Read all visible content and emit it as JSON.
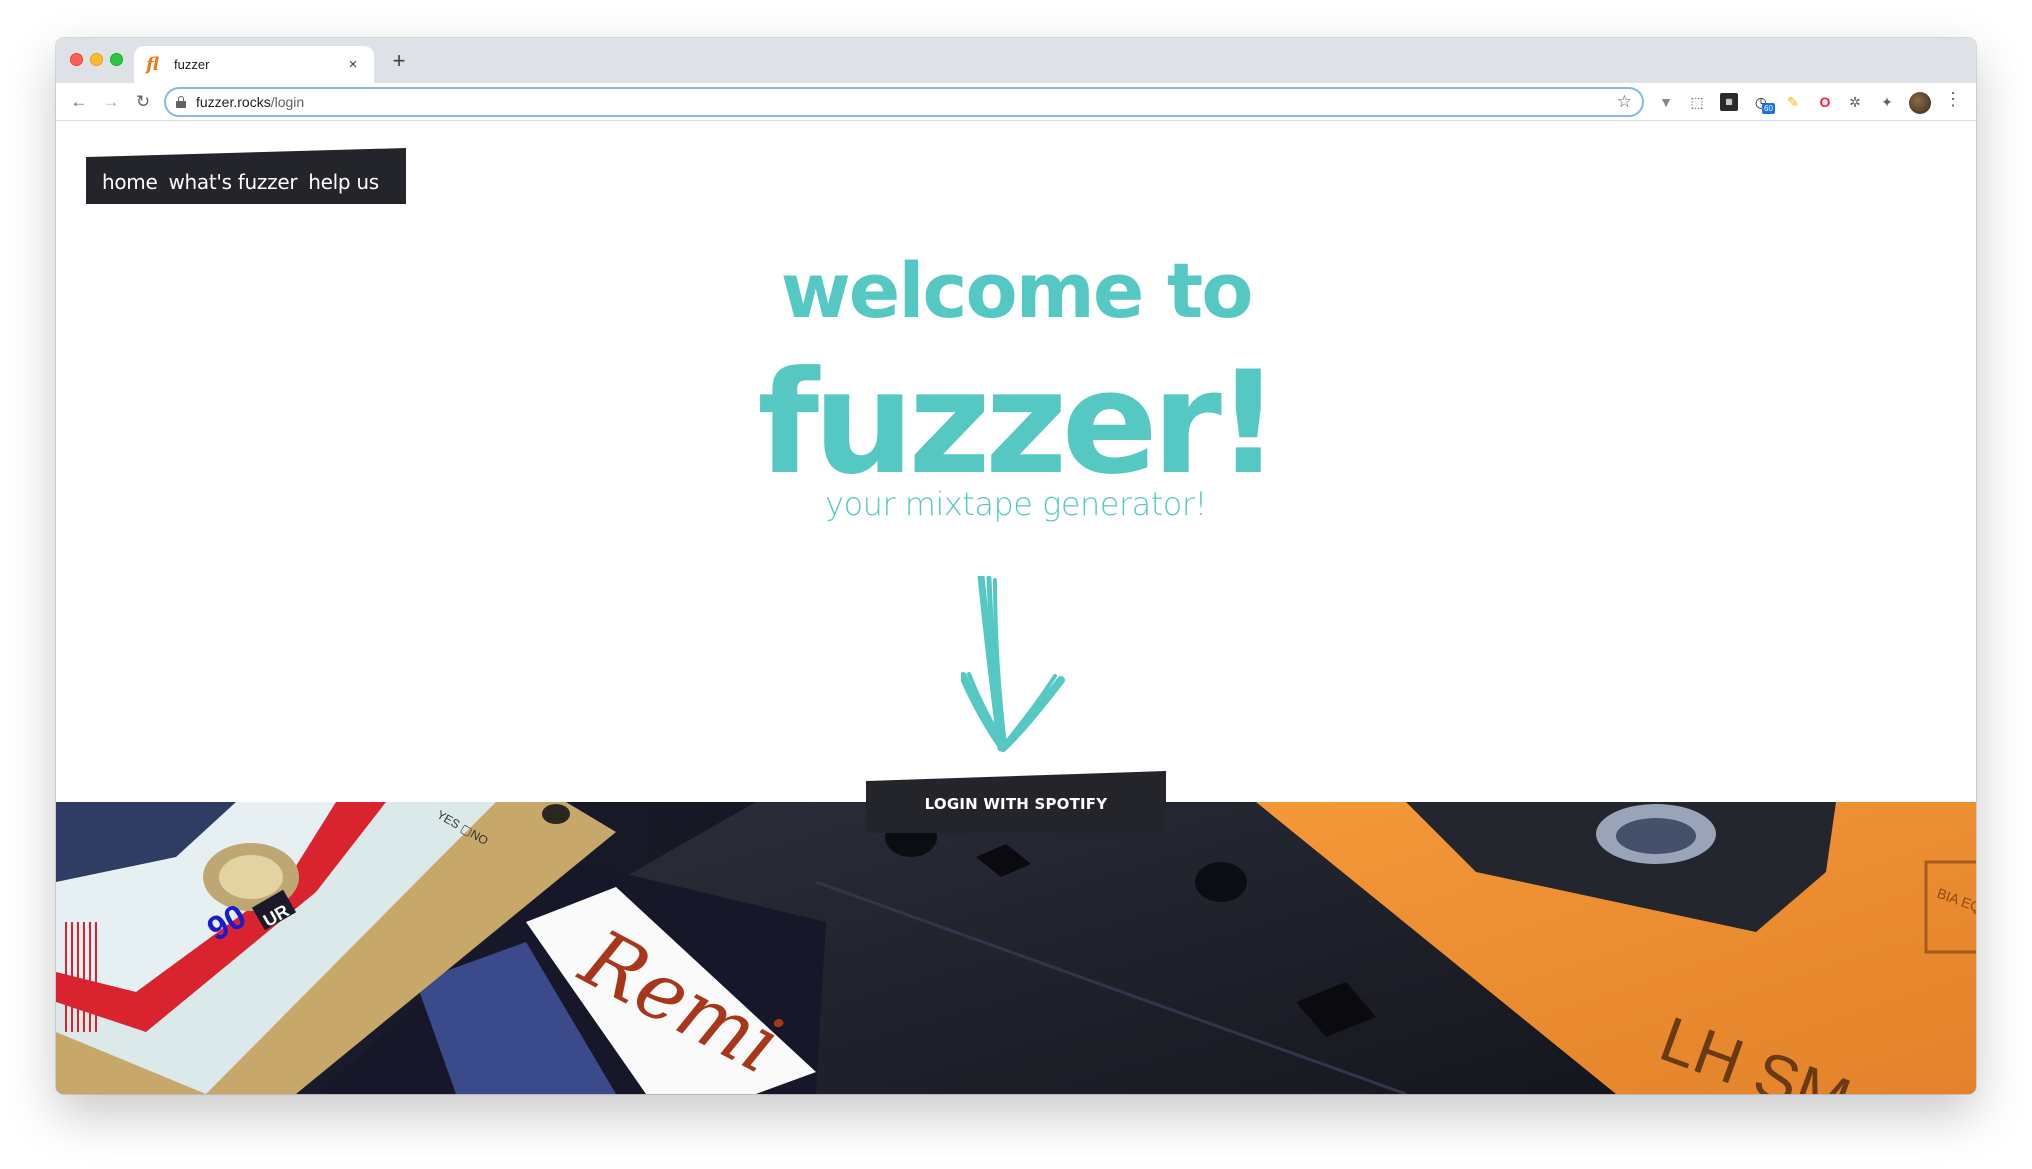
{
  "browser": {
    "tab": {
      "favicon": "fl",
      "title": "fuzzer",
      "close": "×"
    },
    "new_tab": "+",
    "nav": {
      "back": "←",
      "forward": "→",
      "reload": "↻"
    },
    "url": {
      "host": "fuzzer.rocks",
      "path": "/login"
    },
    "bookmark_star": "☆",
    "extensions": {
      "vee": "▼",
      "puzzle_a": "⬚",
      "dark": "▦",
      "clock": "◷",
      "clock_badge": "60",
      "note": "✎",
      "opera": "O",
      "bug": "✲",
      "puzzle": "✦"
    },
    "menu": "⋮"
  },
  "nav": {
    "home": "home",
    "whats_fuzzer": "what's fuzzer",
    "help_us": "help us"
  },
  "hero": {
    "welcome": "welcome to",
    "brand": "fuzzer!",
    "tagline": "your mixtape generator!"
  },
  "login_button": "LOGIN WITH SPOTIFY",
  "hero_image": {
    "tape_label": "90",
    "tape_brand": "UR",
    "remix_label": "Remi",
    "tape_side": "LH SM",
    "checkbox_text": "YES ▢NO",
    "tape_stamp": "BIA EQ"
  },
  "colors": {
    "accent": "#55c8c3",
    "dark": "#23252b",
    "favicon": "#f07a1a"
  }
}
